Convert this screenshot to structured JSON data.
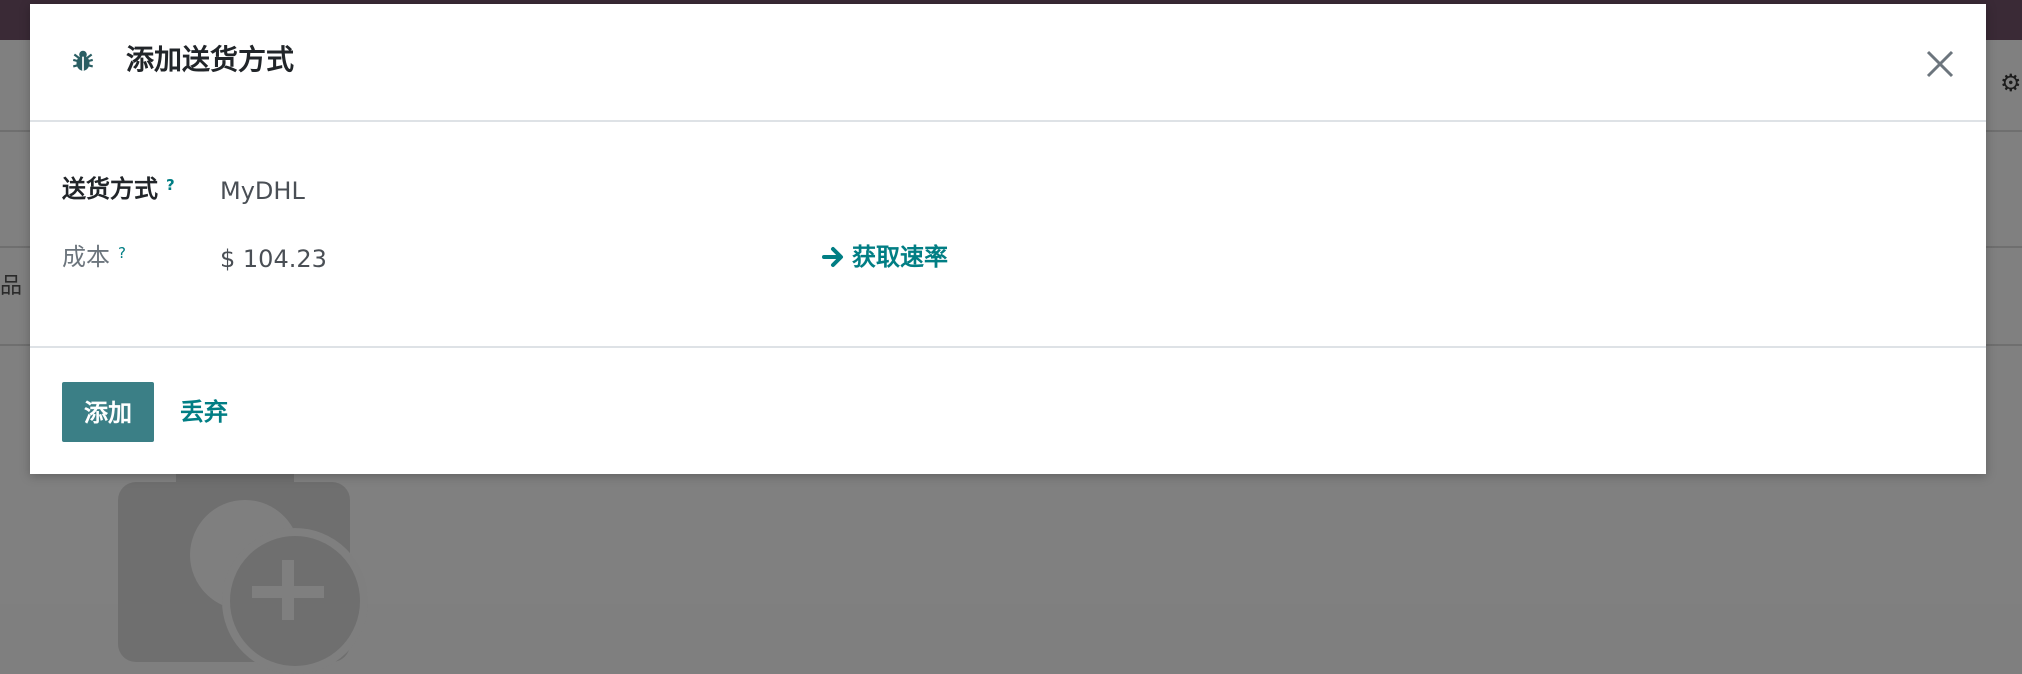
{
  "dialog": {
    "title": "添加送货方式",
    "fields": {
      "carrier": {
        "label": "送货方式",
        "help": "?",
        "value": "MyDHL"
      },
      "cost": {
        "label": "成本",
        "help": "?",
        "value": "$ 104.23"
      }
    },
    "get_rate_label": "获取速率",
    "buttons": {
      "add": "添加",
      "discard": "丢弃"
    }
  },
  "colors": {
    "primary": "#3b7f86",
    "link": "#017e84",
    "overlay": "#808080",
    "topbar": "#3a2a36"
  },
  "icons": {
    "header": "bug-icon",
    "close": "close-icon",
    "rate": "arrow-right-icon",
    "settings": "gear-icon"
  }
}
